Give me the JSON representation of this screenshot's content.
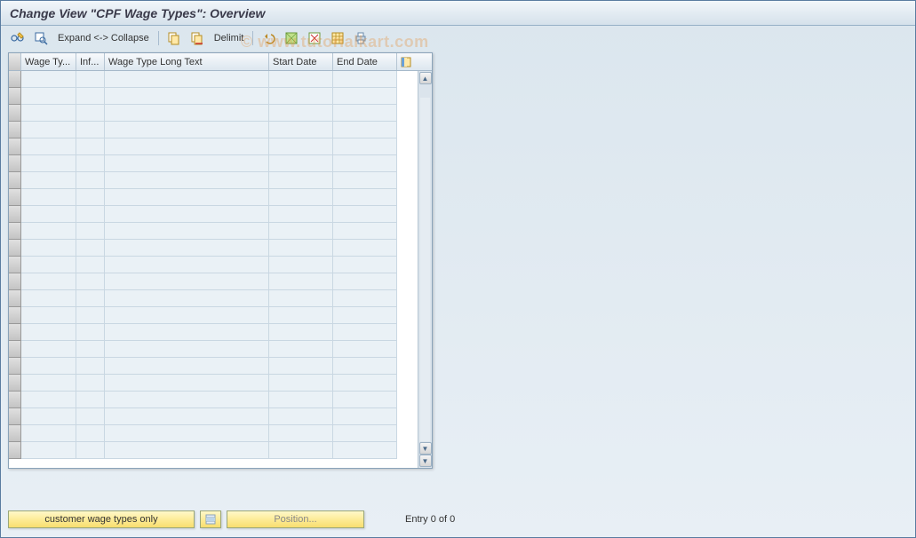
{
  "title": "Change View \"CPF Wage Types\": Overview",
  "toolbar": {
    "expand_label": "Expand <-> Collapse",
    "delimit_label": "Delimit"
  },
  "table": {
    "columns": [
      {
        "label": "Wage Ty...",
        "width": 62
      },
      {
        "label": "Inf...",
        "width": 32
      },
      {
        "label": "Wage Type Long Text",
        "width": 185
      },
      {
        "label": "Start Date",
        "width": 72
      },
      {
        "label": "End Date",
        "width": 72
      }
    ],
    "rows": [
      {},
      {},
      {},
      {},
      {},
      {},
      {},
      {},
      {},
      {},
      {},
      {},
      {},
      {},
      {},
      {},
      {},
      {},
      {},
      {},
      {},
      {},
      {}
    ]
  },
  "footer": {
    "customer_btn": "customer wage types only",
    "position_btn": "Position...",
    "entry_text": "Entry 0 of 0"
  },
  "watermark": "© www.tutorialkart.com"
}
